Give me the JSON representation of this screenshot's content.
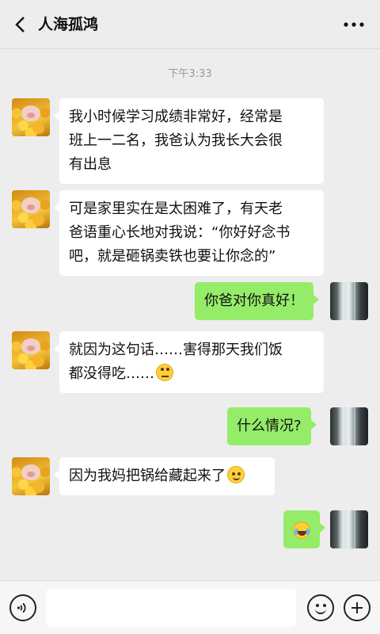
{
  "header": {
    "title": "人海孤鸿",
    "back_icon": "chevron-left-icon",
    "more_icon": "more-dots-icon"
  },
  "chat": {
    "timestamp": "下午3:33",
    "messages": [
      {
        "side": "left",
        "lines": [
          "我小时候学习成绩非常好，经常是",
          "班上一二名，我爸认为我长大会很",
          "有出息"
        ]
      },
      {
        "side": "left",
        "lines": [
          "可是家里实在是太困难了，有天老",
          "爸语重心长地对我说：“你好好念书",
          "吧，就是砸锅卖铁也要让你念的”"
        ]
      },
      {
        "side": "right",
        "lines": [
          "你爸对你真好！"
        ]
      },
      {
        "side": "left",
        "lines": [
          "就因为这句话……害得那天我们饭",
          "都没得吃……"
        ],
        "emoji": "eyeroll-emoji"
      },
      {
        "side": "right",
        "lines": [
          "什么情况?"
        ]
      },
      {
        "side": "left",
        "lines": [
          "因为我妈把锅给藏起来了"
        ],
        "emoji": "grin-sweat-emoji"
      },
      {
        "side": "right",
        "lines": [],
        "emoji": "laugh-cry-emoji"
      }
    ]
  },
  "bottombar": {
    "input_placeholder": "",
    "voice_icon": "voice-icon",
    "emoji_icon": "emoji-icon",
    "plus_icon": "plus-icon"
  },
  "colors": {
    "background": "#ededed",
    "bubble_left": "#ffffff",
    "bubble_right": "#95ec69"
  }
}
